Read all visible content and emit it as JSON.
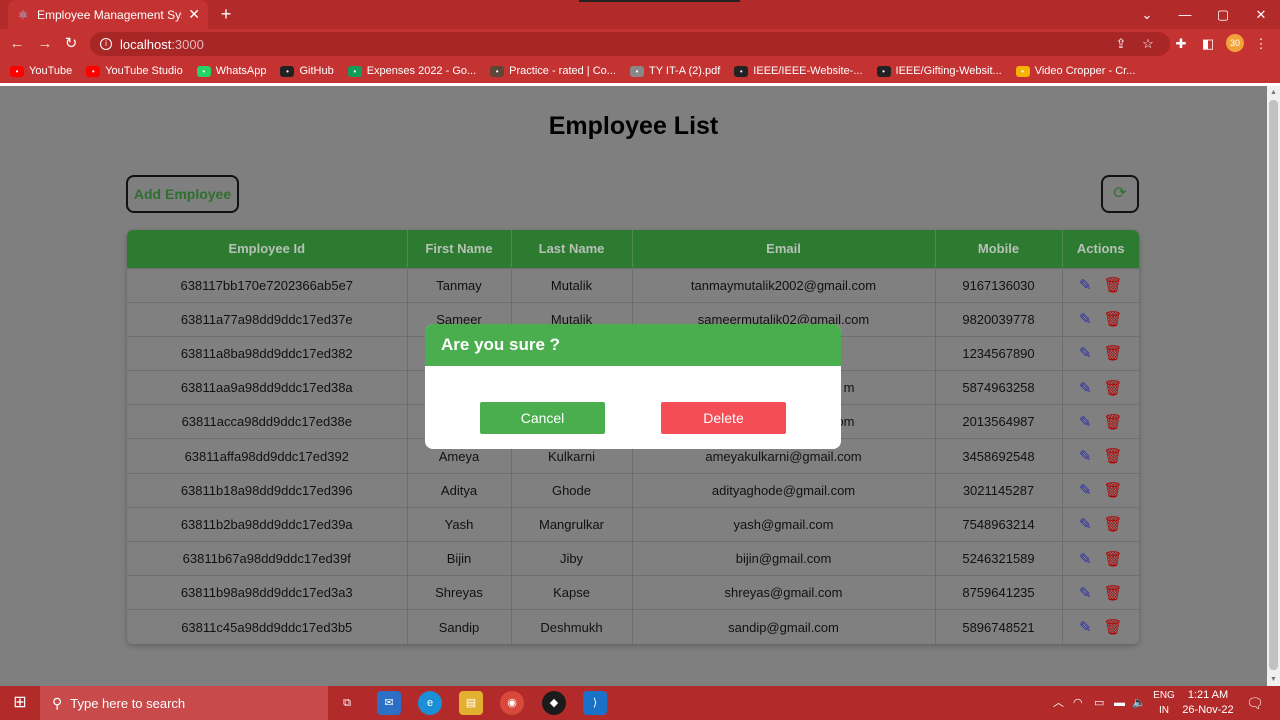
{
  "browser": {
    "tab_title": "Employee Management System",
    "url_host": "localhost",
    "url_port": ":3000",
    "bookmarks": [
      {
        "label": "YouTube",
        "icon": "youtube-icon",
        "color": "#ff0000"
      },
      {
        "label": "YouTube Studio",
        "icon": "youtube-studio-icon",
        "color": "#ff0000"
      },
      {
        "label": "WhatsApp",
        "icon": "whatsapp-icon",
        "color": "#25d366"
      },
      {
        "label": "GitHub",
        "icon": "github-icon",
        "color": "#222222"
      },
      {
        "label": "Expenses 2022 - Go...",
        "icon": "sheets-icon",
        "color": "#0f9d58"
      },
      {
        "label": "Practice - rated | Co...",
        "icon": "codechef-icon",
        "color": "#5b4638"
      },
      {
        "label": "TY IT-A (2).pdf",
        "icon": "globe-icon",
        "color": "#888888"
      },
      {
        "label": "IEEE/IEEE-Website-...",
        "icon": "github-icon",
        "color": "#222222"
      },
      {
        "label": "IEEE/Gifting-Websit...",
        "icon": "github-icon",
        "color": "#222222"
      },
      {
        "label": "Video Cropper - Cr...",
        "icon": "video-cropper-icon",
        "color": "#f5b400"
      }
    ]
  },
  "page": {
    "title": "Employee List",
    "add_button": "Add Employee"
  },
  "table": {
    "headers": [
      "Employee Id",
      "First Name",
      "Last Name",
      "Email",
      "Mobile",
      "Actions"
    ],
    "rows": [
      [
        "638117bb170e7202366ab5e7",
        "Tanmay",
        "Mutalik",
        "tanmaymutalik2002@gmail.com",
        "9167136030"
      ],
      [
        "63811a77a98dd9ddc17ed37e",
        "Sameer",
        "Mutalik",
        "sameermutalik02@gmail.com",
        "9820039778"
      ],
      [
        "63811a8ba98dd9ddc17ed382",
        "",
        "",
        "",
        "1234567890"
      ],
      [
        "63811aa9a98dd9ddc17ed38a",
        "",
        "",
        "m",
        "5874963258"
      ],
      [
        "63811acca98dd9ddc17ed38e",
        "",
        "",
        "om",
        "2013564987"
      ],
      [
        "63811affa98dd9ddc17ed392",
        "Ameya",
        "Kulkarni",
        "ameyakulkarni@gmail.com",
        "3458692548"
      ],
      [
        "63811b18a98dd9ddc17ed396",
        "Aditya",
        "Ghode",
        "adityaghode@gmail.com",
        "3021145287"
      ],
      [
        "63811b2ba98dd9ddc17ed39a",
        "Yash",
        "Mangrulkar",
        "yash@gmail.com",
        "7548963214"
      ],
      [
        "63811b67a98dd9ddc17ed39f",
        "Bijin",
        "Jiby",
        "bijin@gmail.com",
        "5246321589"
      ],
      [
        "63811b98a98dd9ddc17ed3a3",
        "Shreyas",
        "Kapse",
        "shreyas@gmail.com",
        "8759641235"
      ],
      [
        "63811c45a98dd9ddc17ed3b5",
        "Sandip",
        "Deshmukh",
        "sandip@gmail.com",
        "5896748521"
      ]
    ]
  },
  "modal": {
    "title": "Are you sure ?",
    "cancel_label": "Cancel",
    "delete_label": "Delete"
  },
  "taskbar": {
    "search_placeholder": "Type here to search",
    "lang_top": "ENG",
    "lang_bottom": "IN",
    "time": "1:21 AM",
    "date": "26-Nov-22"
  },
  "colors": {
    "header_green": "#2d7a31",
    "modal_green": "#4aae4f",
    "delete_red": "#f44d56",
    "browser_red": "#b22a2a"
  }
}
